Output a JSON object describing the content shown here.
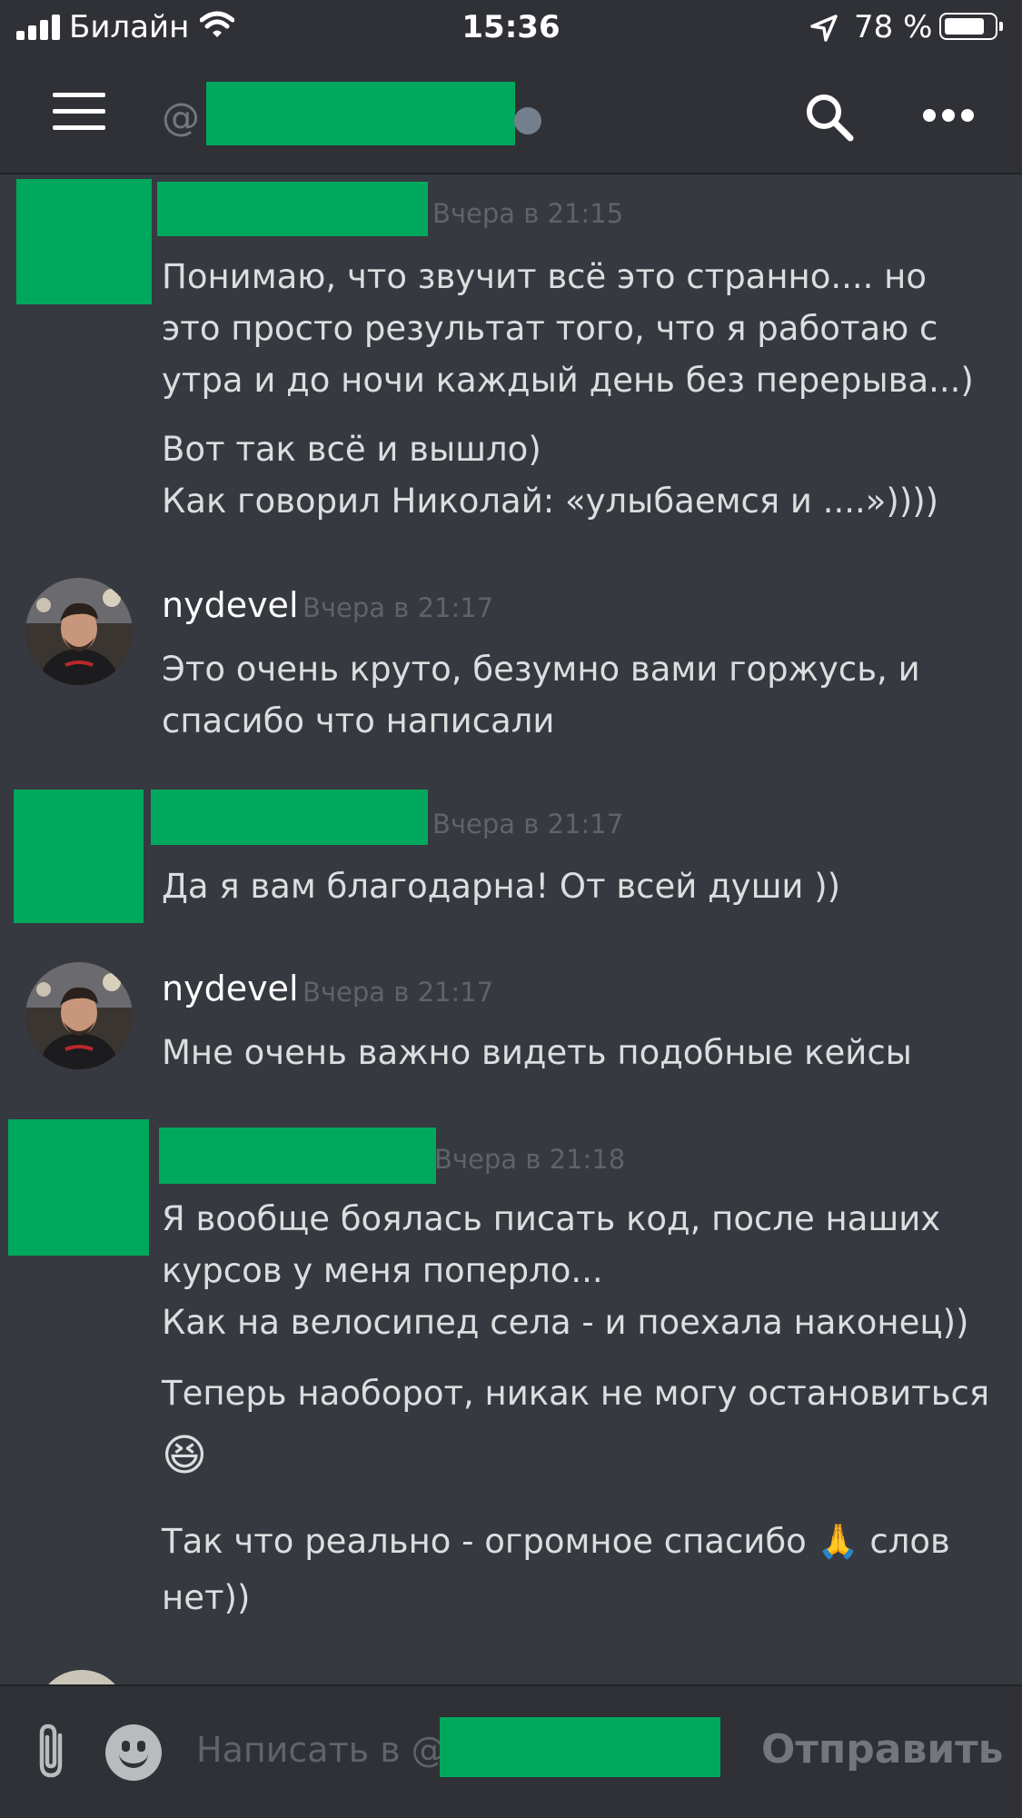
{
  "status_bar": {
    "carrier": "Билайн",
    "time": "15:36",
    "battery": "78 %"
  },
  "header": {
    "channel_prefix": "@"
  },
  "messages": [
    {
      "author": "",
      "timestamp": "Вчера в 21:15",
      "paragraphs": [
        [
          "Понимаю, что звучит всё это странно.... но",
          "это просто результат того, что я работаю с",
          "утра и до ночи каждый день без перерыва...)"
        ],
        [
          "Вот так всё и вышло)",
          "Как говорил Николай: «улыбаемся и ....»))))"
        ]
      ]
    },
    {
      "author": "nydevel",
      "timestamp": "Вчера в 21:17",
      "paragraphs": [
        [
          "Это очень круто, безумно вами горжусь, и",
          "спасибо что написали"
        ]
      ]
    },
    {
      "author": "",
      "timestamp": "Вчера в 21:17",
      "paragraphs": [
        [
          "Да я вам благодарна! От всей души ))"
        ]
      ]
    },
    {
      "author": "nydevel",
      "timestamp": "Вчера в 21:17",
      "paragraphs": [
        [
          "Мне очень важно видеть подобные кейсы"
        ]
      ]
    },
    {
      "author": "",
      "timestamp": "Вчера в 21:18",
      "paragraphs": [
        [
          "Я вообще боялась писать код, после наших",
          "курсов у меня поперло...",
          "Как на велосипед села - и поехала наконец))"
        ],
        [
          "Теперь наоборот, никак не могу остановиться",
          "😆"
        ],
        [
          "Так что реально - огромное спасибо 🙏 слов",
          "нет))"
        ]
      ]
    }
  ],
  "input": {
    "placeholder": "Написать в @",
    "send_label": "Отправить"
  },
  "colors": {
    "background": "#36393f",
    "header": "#2f3136",
    "redaction": "#00a85d",
    "username": "#ffffff",
    "timestamp": "#5f636a",
    "text": "#dcddde"
  }
}
